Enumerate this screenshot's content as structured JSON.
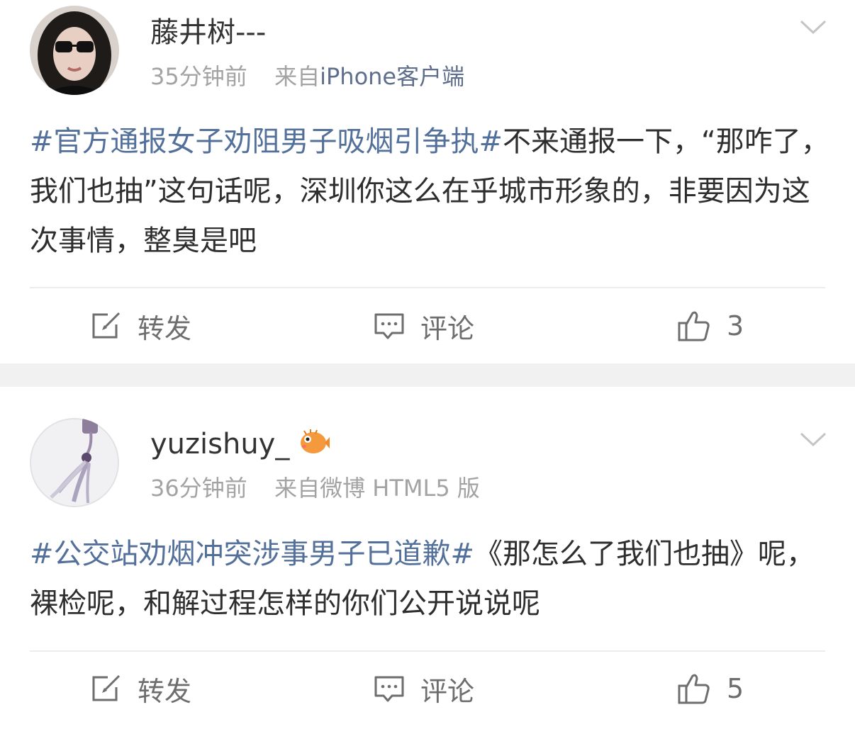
{
  "posts": [
    {
      "username": "藤井树---",
      "time": "35分钟前",
      "source_prefix": "来自",
      "source_name": "iPhone客户端",
      "hashtag": "#官方通报女子劝阻男子吸烟引争执#",
      "text": "不来通报一下，“那咋了，我们也抽”这句话呢，深圳你这么在乎城市形象的，非要因为这次事情，整臭是吧",
      "actions": {
        "repost": "转发",
        "comment": "评论",
        "likes": "3"
      }
    },
    {
      "username": "yuzishuy_",
      "time": "36分钟前",
      "source_prefix": "来自",
      "source_name": "微博 HTML5 版",
      "hashtag": "#公交站劝烟冲突涉事男子已道歉#",
      "text": "《那怎么了我们也抽》呢，裸检呢，和解过程怎样的你们公开说说呢",
      "actions": {
        "repost": "转发",
        "comment": "评论",
        "likes": "5"
      }
    }
  ],
  "colors": {
    "hashtag": "#53709b",
    "meta": "#a3a3a3",
    "text": "#2e2e2e",
    "separator": "#f1f1f1"
  },
  "icons": {
    "chevron": "chevron-down-icon",
    "repost": "repost-icon",
    "comment": "comment-icon",
    "like": "thumbs-up-icon",
    "badge": "pufferfish-badge-icon"
  }
}
